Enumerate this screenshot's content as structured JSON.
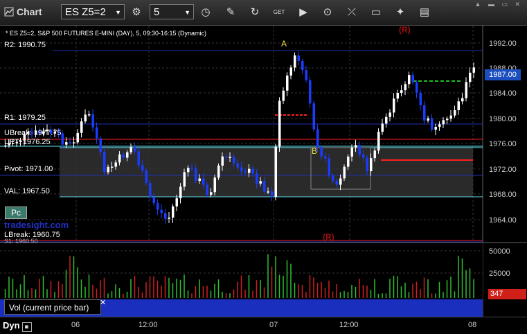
{
  "toolbar": {
    "title": "Chart",
    "symbol": "ES Z5=2",
    "interval": "5",
    "icons": [
      "settings-icon",
      "clock-icon",
      "pencil-icon",
      "refresh-icon",
      "get-icon",
      "play-icon",
      "cursor-icon",
      "link-icon",
      "comment-icon",
      "twitter-icon",
      "book-icon"
    ]
  },
  "legend": "* ES Z5=2, S&P 500 FUTURES E-MINI (DAY), 5, 09:30-16:15 (Dynamic)",
  "levels": {
    "r2": "R2: 1990.75",
    "r1": "R1: 1979.25",
    "ubreak": "UBreak: 1977.75",
    "upt": "UPT: 1976.25",
    "pivot": "Pivot: 1971.00",
    "val": "VAL: 1967.50",
    "lbreak": "LBreak: 1960.75",
    "s1": "S1: 1960.50"
  },
  "annotations": {
    "a": "A",
    "b": "B",
    "r_top": "(R)",
    "r_bottom": "(R)"
  },
  "badges": {
    "pc": "Pc",
    "brand": "tradesight.com"
  },
  "price_axis": {
    "ticks": [
      "1992.00",
      "1988.00",
      "1984.00",
      "1980.00",
      "1976.00",
      "1972.00",
      "1968.00",
      "1964.00"
    ],
    "last_price": "1987.00"
  },
  "volume_axis": {
    "ticks": [
      "50000",
      "25000"
    ],
    "last_volume": "347"
  },
  "volume_panel_label": "Vol (current price bar)",
  "x_axis": {
    "dyn": "Dyn",
    "ticks": [
      "06",
      "12:00",
      "07",
      "12:00",
      "08"
    ]
  },
  "colors": {
    "up": "#ffffff",
    "down": "#1a3cff",
    "vol_up": "#30c030",
    "vol_down": "#d02020",
    "line_blue": "#2030b0",
    "line_red": "#ff2020",
    "line_cyan": "#60e0f0"
  }
}
